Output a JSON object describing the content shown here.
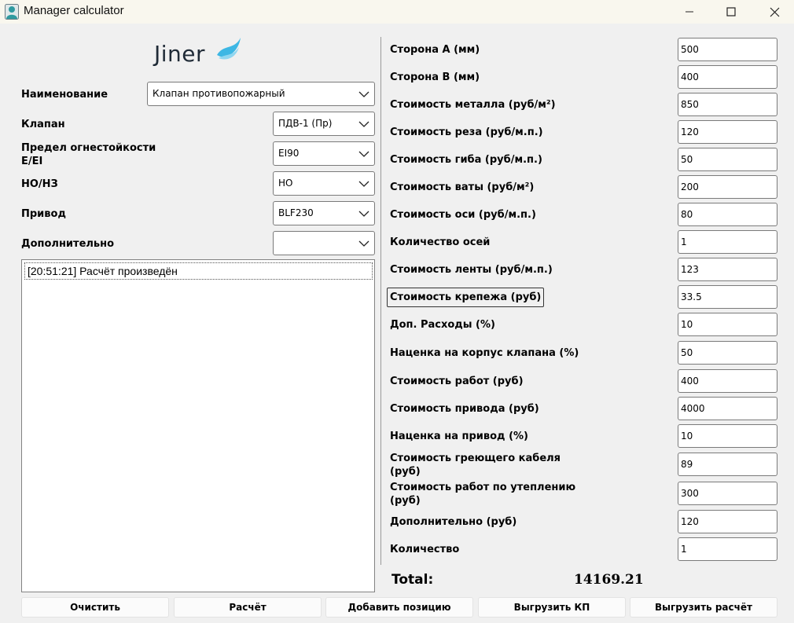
{
  "window": {
    "title": "Manager calculator",
    "app_icon": "user-avatar-icon"
  },
  "logo": {
    "text": "Jiner",
    "accent": "#3db7e4"
  },
  "left": {
    "fields": [
      {
        "label": "Наименование",
        "value": "Клапан противопожарный"
      },
      {
        "label": "Клапан",
        "value": "ПДВ-1 (Пр)"
      },
      {
        "label": "Предел огнестойкости\nE/EI",
        "value": "EI90"
      },
      {
        "label": "НО/НЗ",
        "value": "НО"
      },
      {
        "label": "Привод",
        "value": "BLF230"
      },
      {
        "label": "Дополнительно",
        "value": ""
      }
    ],
    "log": [
      "[20:51:21] Расчёт произведён"
    ]
  },
  "right": {
    "fields": [
      {
        "label": "Сторона A (мм)",
        "value": "500"
      },
      {
        "label": "Сторона B (мм)",
        "value": "400"
      },
      {
        "label": "Стоимость металла (руб/м²)",
        "value": "850"
      },
      {
        "label": "Стоимость реза (руб/м.п.)",
        "value": "120"
      },
      {
        "label": "Стоимость гиба (руб/м.п.)",
        "value": "50"
      },
      {
        "label": "Стоимость ваты (руб/м²)",
        "value": "200"
      },
      {
        "label": "Стоимость оси (руб/м.п.)",
        "value": "80"
      },
      {
        "label": "Количество осей",
        "value": "1"
      },
      {
        "label": "Стоимость ленты (руб/м.п.)",
        "value": "123"
      },
      {
        "label": "Стоимость крепежа (руб)",
        "value": "33.5"
      },
      {
        "label": "Доп. Расходы (%)",
        "value": "10"
      },
      {
        "label": "Наценка на корпус клапана (%)",
        "value": "50"
      },
      {
        "label": "Стоимость работ (руб)",
        "value": "400"
      },
      {
        "label": "Стоимость привода (руб)",
        "value": "4000"
      },
      {
        "label": "Наценка на привод (%)",
        "value": "10"
      },
      {
        "label": "Стоимость греющего кабеля\n(руб)",
        "value": "89"
      },
      {
        "label": "Стоимость работ по утеплению\n(руб)",
        "value": "300"
      },
      {
        "label": "Дополнительно (руб)",
        "value": "120"
      },
      {
        "label": "Количество",
        "value": "1"
      }
    ],
    "total_label": "Total:",
    "total_value": "14169.21"
  },
  "buttons": {
    "clear": "Очистить",
    "calculate": "Расчёт",
    "add_position": "Добавить позицию",
    "export_kp": "Выгрузить КП",
    "export_calc": "Выгрузить расчёт"
  }
}
